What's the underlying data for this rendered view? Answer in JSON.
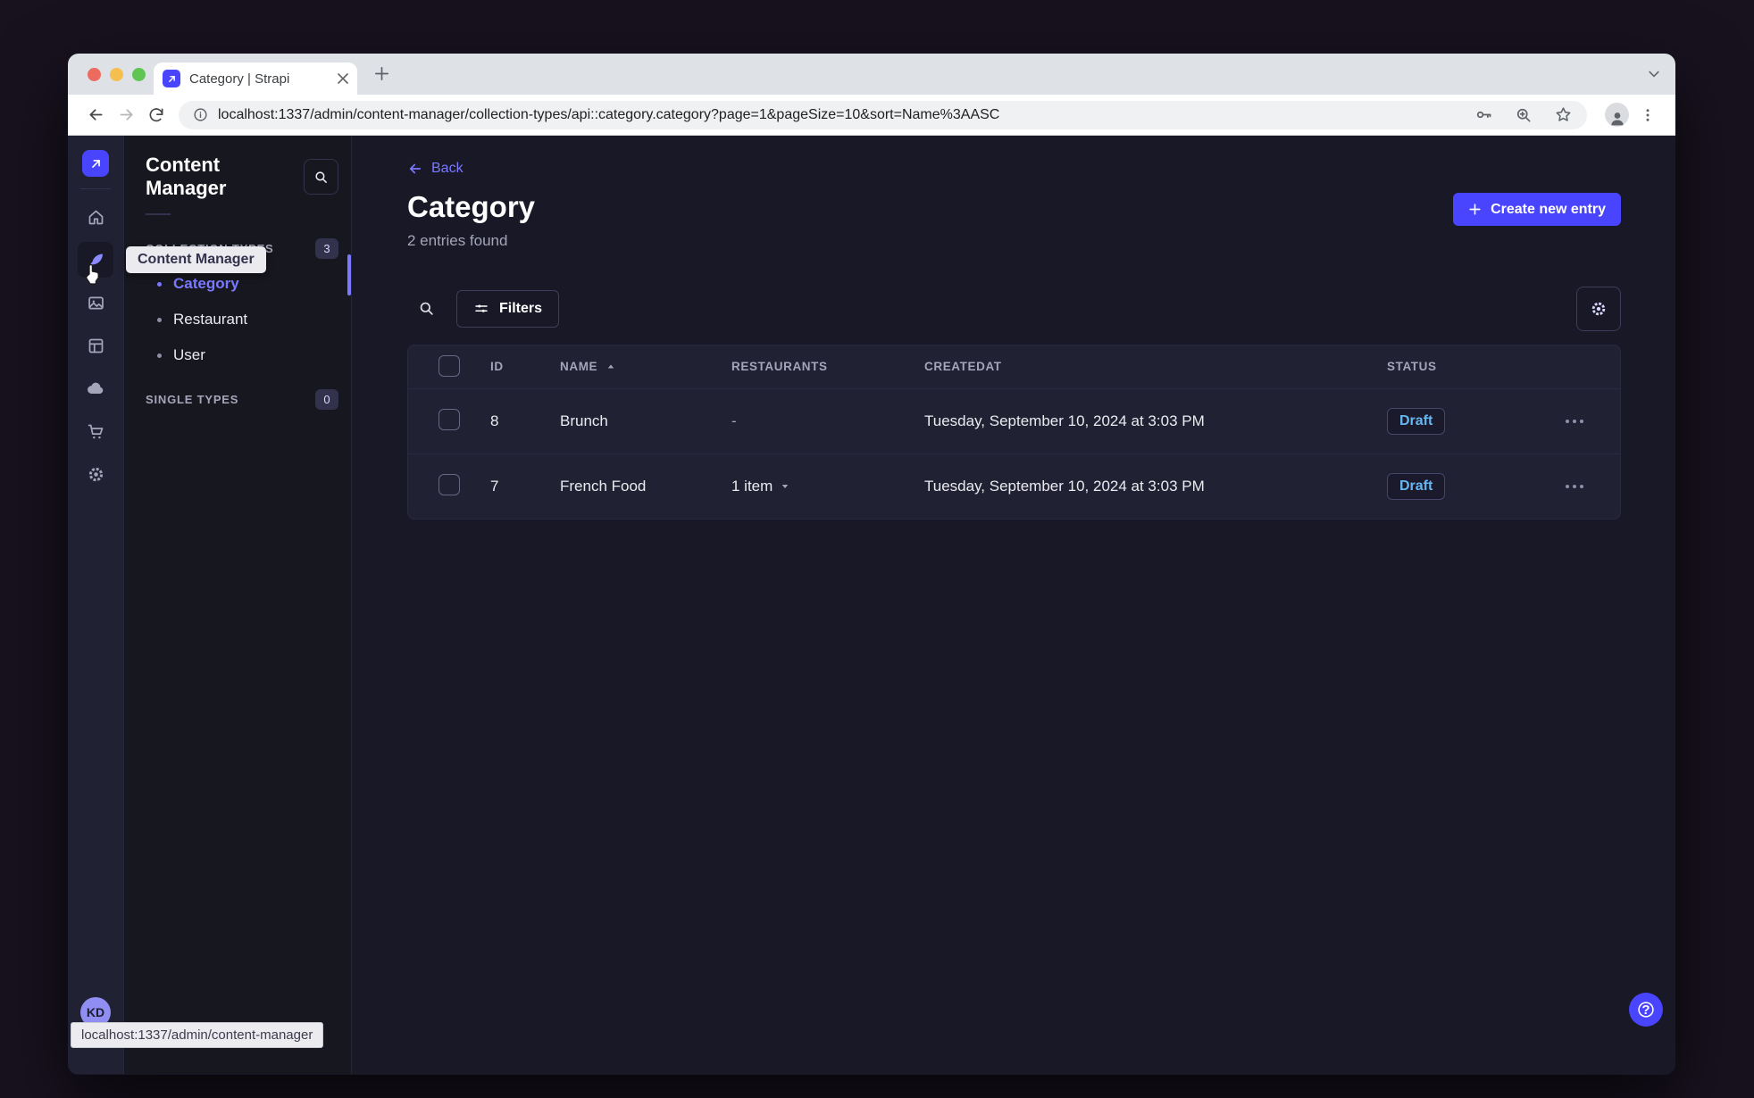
{
  "browser": {
    "tab_title": "Category | Strapi",
    "url": "localhost:1337/admin/content-manager/collection-types/api::category.category?page=1&pageSize=10&sort=Name%3AASC",
    "status_bar": "localhost:1337/admin/content-manager"
  },
  "colors": {
    "accent": "#4945ff",
    "link": "#7b79ff",
    "draft_text": "#66b7f1",
    "rail_bg": "#212134",
    "page_bg": "#181826"
  },
  "sidebar": {
    "tooltip": "Content Manager",
    "avatar_initials": "KD"
  },
  "subnav": {
    "title": "Content Manager",
    "sections": [
      {
        "label": "COLLECTION TYPES",
        "count": "3",
        "items": [
          {
            "label": "Category"
          },
          {
            "label": "Restaurant"
          },
          {
            "label": "User"
          }
        ]
      },
      {
        "label": "SINGLE TYPES",
        "count": "0",
        "items": []
      }
    ]
  },
  "main": {
    "back_label": "Back",
    "title": "Category",
    "subtitle": "2 entries found",
    "create_button": "Create new entry",
    "filters_button": "Filters",
    "table": {
      "headers": [
        "ID",
        "NAME",
        "RESTAURANTS",
        "CREATEDAT",
        "STATUS"
      ],
      "rows": [
        {
          "id": "8",
          "name": "Brunch",
          "restaurants": "-",
          "created_at": "Tuesday, September 10, 2024 at 3:03 PM",
          "status": "Draft"
        },
        {
          "id": "7",
          "name": "French Food",
          "restaurants": "1 item",
          "created_at": "Tuesday, September 10, 2024 at 3:03 PM",
          "status": "Draft"
        }
      ]
    }
  },
  "icons": {
    "help": "?"
  }
}
